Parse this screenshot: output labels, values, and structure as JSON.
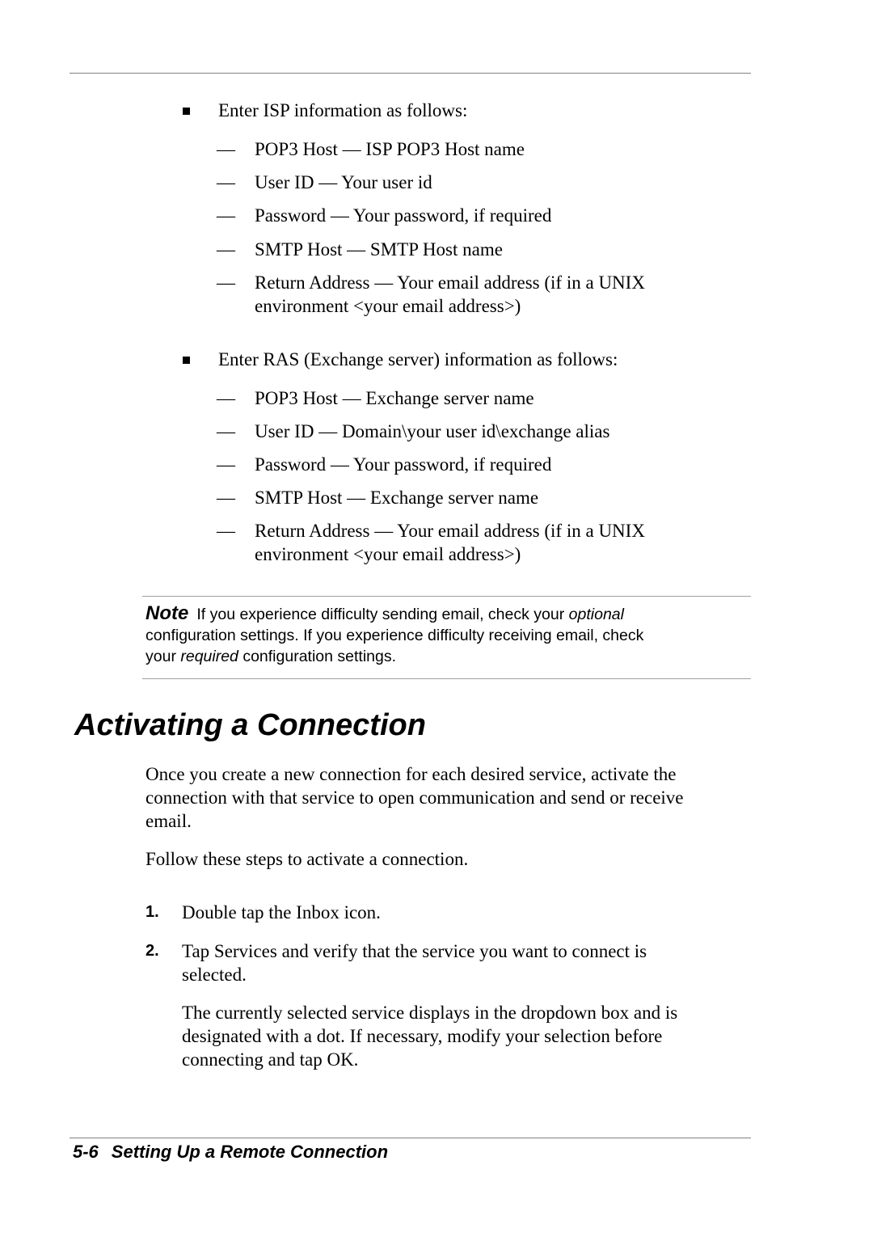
{
  "isp_section": {
    "intro": "Enter ISP information as follows:",
    "items": [
      "POP3 Host — ISP POP3 Host name",
      "User ID — Your user id",
      "Password — Your password, if required",
      "SMTP Host — SMTP Host name",
      "Return Address — Your email address (if in a UNIX",
      "environment <your email address>)"
    ]
  },
  "ras_section": {
    "intro": "Enter RAS (Exchange server) information as follows:",
    "items": [
      "POP3 Host — Exchange server name",
      "User ID — Domain\\your user id\\exchange alias",
      "Password — Your password, if required",
      "SMTP Host — Exchange server name",
      "Return Address — Your email address (if in a UNIX",
      "environment <your email address>)"
    ]
  },
  "note": {
    "label": "Note",
    "line1_a": "If you experience difficulty sending email, check your ",
    "line1_em": "optional",
    "line2": "configuration settings. If you experience difficulty receiving email, check",
    "line3_a": "your ",
    "line3_em": "required",
    "line3_b": " configuration settings."
  },
  "heading": "Activating a Connection",
  "paragraphs": [
    "Once you create a new connection for each desired service, activate the",
    "connection with that service to open communication and send or receive",
    "email.",
    "Follow these steps to activate a connection."
  ],
  "steps": [
    {
      "num": "1.",
      "lines": [
        "Double tap the Inbox icon."
      ]
    },
    {
      "num": "2.",
      "lines": [
        "Tap Services and verify that the service you want to connect is",
        "selected."
      ]
    }
  ],
  "step_detail": [
    "The currently selected service displays in the dropdown box and is",
    "designated with a dot. If necessary, modify your selection before",
    "connecting and tap OK."
  ],
  "footer": {
    "page_number": "5-6",
    "chapter_title": "Setting Up a Remote Connection"
  }
}
